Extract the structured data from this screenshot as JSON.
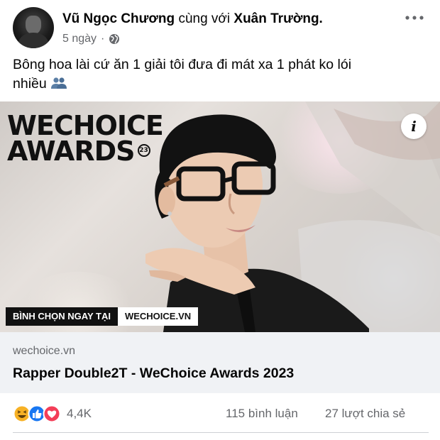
{
  "post": {
    "author": "Vũ Ngọc Chương",
    "with_text": "cùng với",
    "tagged": "Xuân Trường.",
    "time": "5 ngày",
    "separator": "·",
    "privacy_icon": "globe-icon",
    "more_icon": "more-horizontal-icon",
    "text_line1": "Bông hoa lài cứ ăn 1 giải tôi đưa đi mát xa 1 phát ko lói",
    "text_line2": "nhiều",
    "emoji_icon": "people-silhouette-icon"
  },
  "link_preview": {
    "image": {
      "brand_line1": "WECHOICE",
      "brand_line2": "AWARDS",
      "year_badge": "23",
      "info_label": "i",
      "vote_label": "BÌNH CHỌN NGAY TẠI",
      "vote_site": "WECHOICE.VN"
    },
    "domain": "wechoice.vn",
    "title": "Rapper Double2T - WeChoice Awards 2023"
  },
  "reactions": {
    "icons": [
      "haha-icon",
      "like-icon",
      "love-icon"
    ],
    "count": "4,4K",
    "comments": "115 bình luận",
    "shares": "27 lượt chia sẻ"
  },
  "colors": {
    "text_primary": "#050505",
    "text_secondary": "#65676b",
    "link_bg": "#f0f2f5",
    "like_blue": "#1877f2",
    "love_red": "#f33e58",
    "haha_yellow": "#f7b125"
  }
}
